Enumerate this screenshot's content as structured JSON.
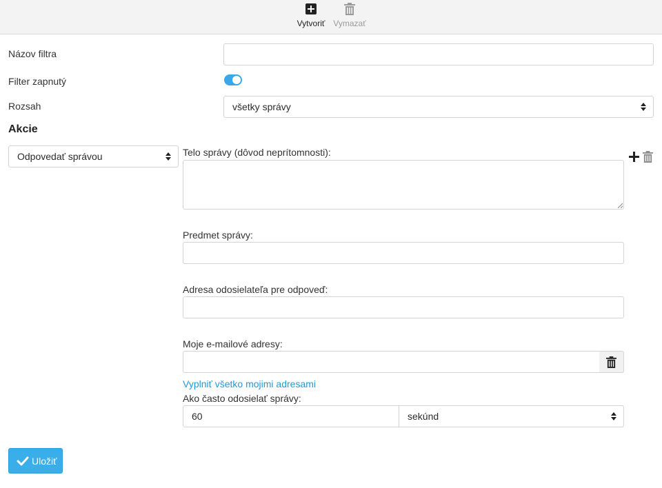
{
  "toolbar": {
    "create_label": "Vytvoriť",
    "create_icon": "plus-square-icon",
    "delete_label": "Vymazať",
    "delete_icon": "trash-icon",
    "delete_disabled": true
  },
  "form": {
    "filter_name_label": "Názov filtra",
    "filter_name_value": "",
    "filter_enabled_label": "Filter zapnutý",
    "filter_enabled": true,
    "scope_label": "Rozsah",
    "scope_value": "všetky správy"
  },
  "actions": {
    "heading": "Akcie",
    "action_type": "Odpovedať správou",
    "add_icon": "plus-icon",
    "remove_icon": "trash-icon",
    "body_label": "Telo správy (dôvod neprítomnosti):",
    "body_value": "",
    "subject_label": "Predmet správy:",
    "subject_value": "",
    "sender_label": "Adresa odosielateľa pre odpoveď:",
    "sender_value": "",
    "my_addresses_label": "Moje e-mailové adresy:",
    "my_addresses_value": "",
    "fill_addresses_link": "Vyplniť všetko mojimi adresami",
    "frequency_label": "Ako často odosielať správy:",
    "frequency_value": "60",
    "frequency_unit": "sekúnd"
  },
  "save_label": "Uložiť",
  "colors": {
    "accent": "#3aaee9",
    "link": "#1e9ad8",
    "toolbar_bg": "#f3f3f3"
  }
}
